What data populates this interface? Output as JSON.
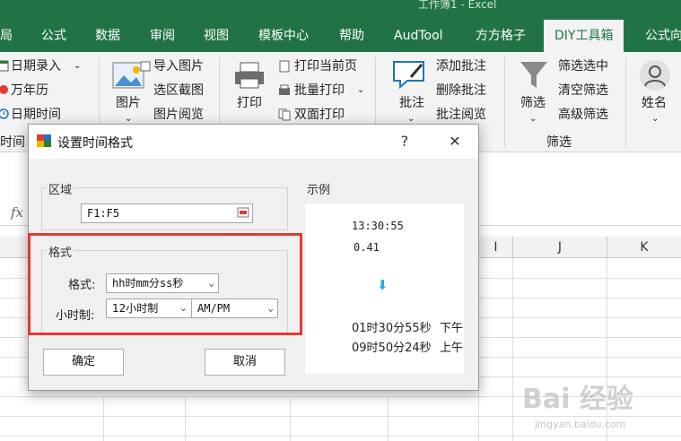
{
  "app": {
    "window_title": "工作簿1 - Excel"
  },
  "tabs": [
    "局",
    "公式",
    "数据",
    "审阅",
    "视图",
    "模板中心",
    "帮助",
    "AudTool",
    "方方格子",
    "DIY工具箱",
    "公式向"
  ],
  "active_tab": "DIY工具箱",
  "ribbon": {
    "date_group": {
      "date_input": "日期录入",
      "calendar": "万年历",
      "date_time": "日期时间",
      "time": "时间"
    },
    "picture_group": {
      "picture": "图片",
      "import_picture": "导入图片",
      "screenshot": "选区截图",
      "picture_browse": "图片阅览"
    },
    "print_group": {
      "print": "打印",
      "print_current": "打印当前页",
      "batch_print": "批量打印",
      "duplex_print": "双面打印"
    },
    "comment_group": {
      "comment": "批注",
      "add_comment": "添加批注",
      "delete_comment": "删除批注",
      "comment_browse": "批注阅览"
    },
    "filter_group": {
      "filter": "筛选",
      "filter_selected": "筛选选中",
      "clear_filter": "清空筛选",
      "advanced_filter": "高级筛选",
      "group_label": "筛选"
    },
    "name": "姓名"
  },
  "sheet": {
    "fx": "fx",
    "columns": [
      "I",
      "J",
      "K"
    ]
  },
  "dialog": {
    "title": "设置时间格式",
    "help": "?",
    "close": "✕",
    "region_label": "区域",
    "region_value": "F1:F5",
    "format_group": "格式",
    "format_label": "格式:",
    "format_value": "hh时mm分ss秒",
    "hour_label": "小时制:",
    "hour_value": "12小时制",
    "ampm_value": "AM/PM",
    "example_label": "示例",
    "example_time": "13:30:55",
    "example_decimal": "0.41",
    "example_arrow": "⬇",
    "result1": "01时30分55秒",
    "result1_suffix": "下午",
    "result2": "09时50分24秒",
    "result2_suffix": "上午",
    "ok": "确定",
    "cancel": "取消"
  },
  "colors": {
    "excel_green": "#217346",
    "highlight_red": "#e53935",
    "arrow_blue": "#29a8e0"
  },
  "watermark": {
    "main": "Bai 经验",
    "sub": "jingyan.baidu.com"
  }
}
